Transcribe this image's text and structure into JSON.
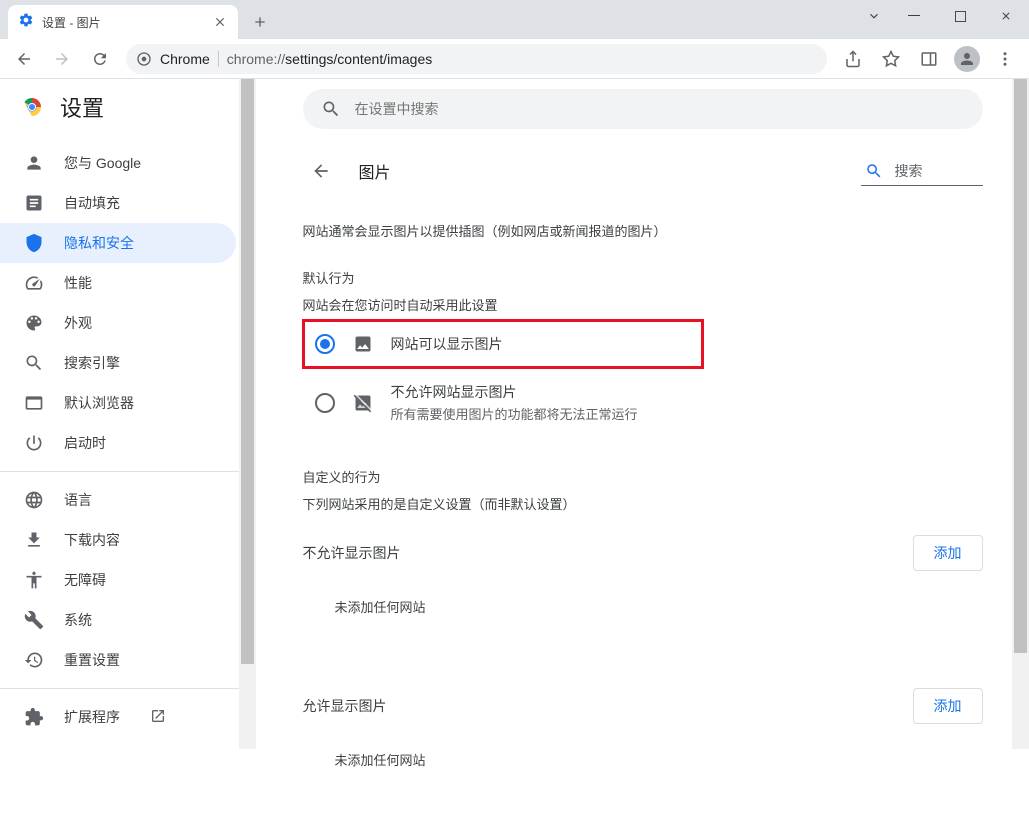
{
  "window": {
    "tab_title": "设置 - 图片"
  },
  "omnibox": {
    "chrome_label": "Chrome",
    "url_prefix": "chrome://",
    "url_path": "settings/content/images"
  },
  "app": {
    "title": "设置",
    "search_placeholder": "在设置中搜索"
  },
  "sidebar": {
    "items": [
      {
        "label": "您与 Google"
      },
      {
        "label": "自动填充"
      },
      {
        "label": "隐私和安全"
      },
      {
        "label": "性能"
      },
      {
        "label": "外观"
      },
      {
        "label": "搜索引擎"
      },
      {
        "label": "默认浏览器"
      },
      {
        "label": "启动时"
      }
    ],
    "items2": [
      {
        "label": "语言"
      },
      {
        "label": "下载内容"
      },
      {
        "label": "无障碍"
      },
      {
        "label": "系统"
      },
      {
        "label": "重置设置"
      }
    ],
    "extensions": "扩展程序"
  },
  "page": {
    "title": "图片",
    "search_label": "搜索",
    "intro": "网站通常会显示图片以提供插图（例如网店或新闻报道的图片）",
    "default_behavior_title": "默认行为",
    "default_behavior_sub": "网站会在您访问时自动采用此设置",
    "radio_allow": "网站可以显示图片",
    "radio_block": "不允许网站显示图片",
    "radio_block_sub": "所有需要使用图片的功能都将无法正常运行",
    "custom_title": "自定义的行为",
    "custom_sub": "下列网站采用的是自定义设置（而非默认设置）",
    "block_list_title": "不允许显示图片",
    "allow_list_title": "允许显示图片",
    "add_button": "添加",
    "empty_text": "未添加任何网站"
  }
}
